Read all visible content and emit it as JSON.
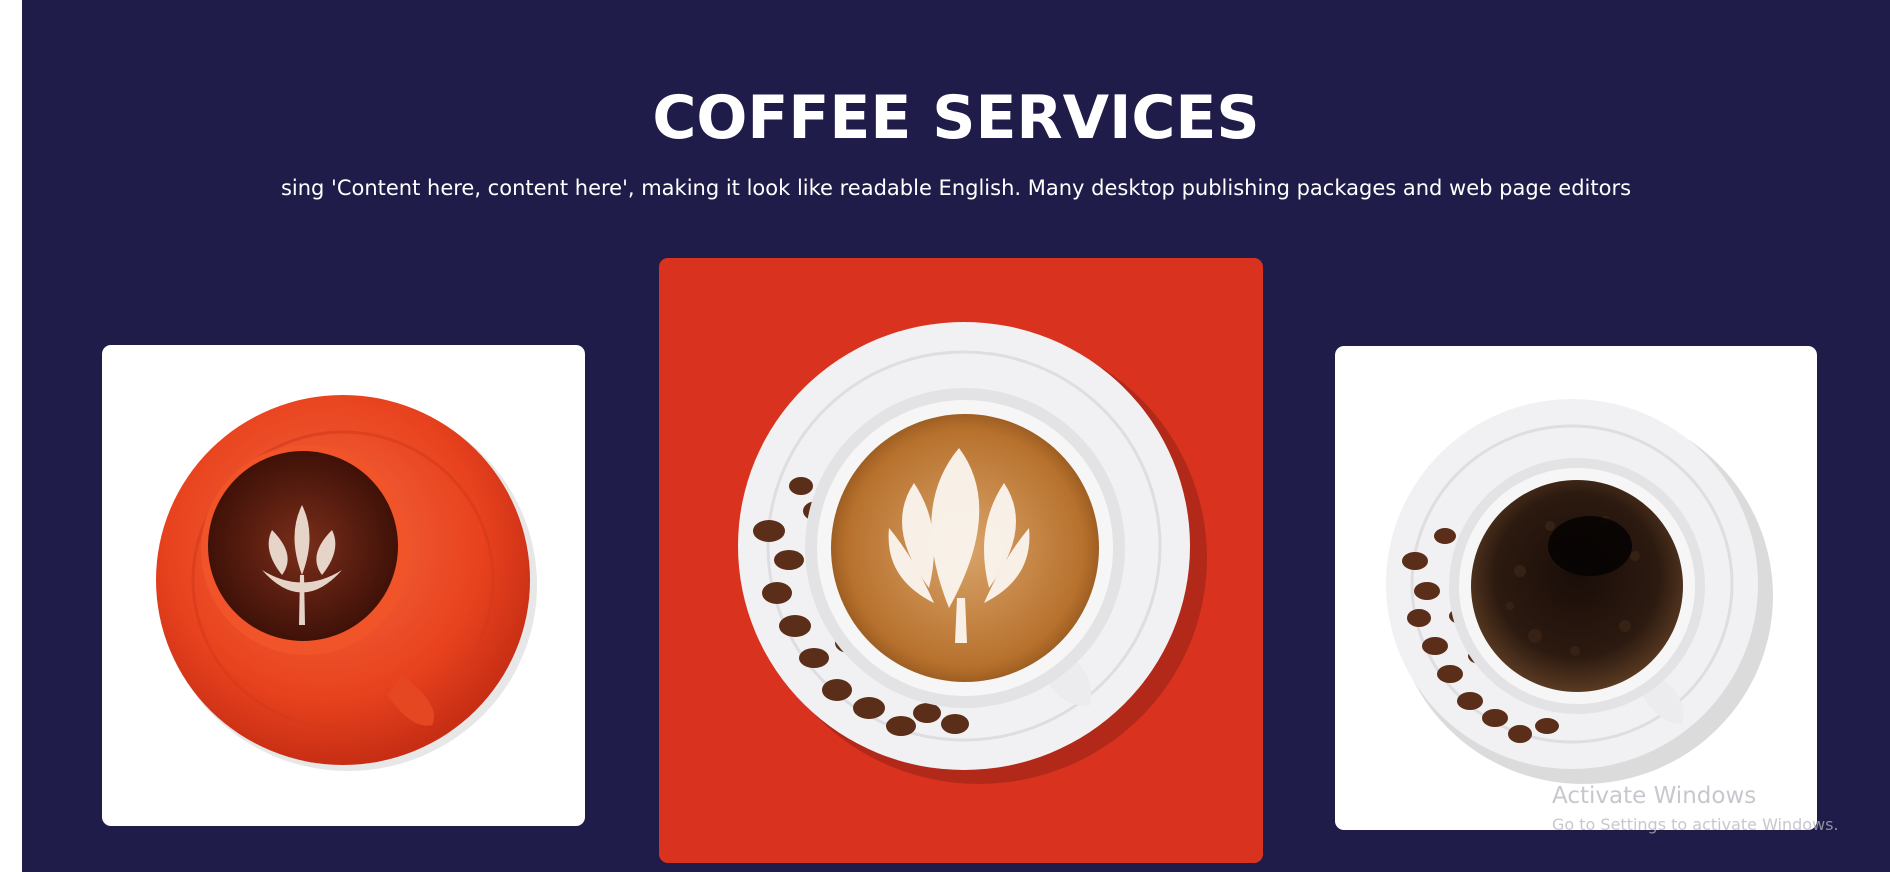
{
  "section": {
    "heading": "COFFEE SERVICES",
    "subtitle": "sing 'Content here, content here', making it look like readable English. Many desktop publishing packages and web page editors"
  },
  "cards": [
    {
      "image": "latte-art-cup-on-orange-saucer",
      "background": "#ffffff"
    },
    {
      "image": "cappuccino-cup-with-coffee-beans",
      "background": "#d9331f"
    },
    {
      "image": "black-coffee-cup-with-coffee-beans",
      "background": "#ffffff"
    }
  ],
  "colors": {
    "page_background": "#201c4a",
    "accent": "#d9331f",
    "text": "#ffffff"
  },
  "watermark": {
    "title": "Activate Windows",
    "subtitle": "Go to Settings to activate Windows."
  }
}
